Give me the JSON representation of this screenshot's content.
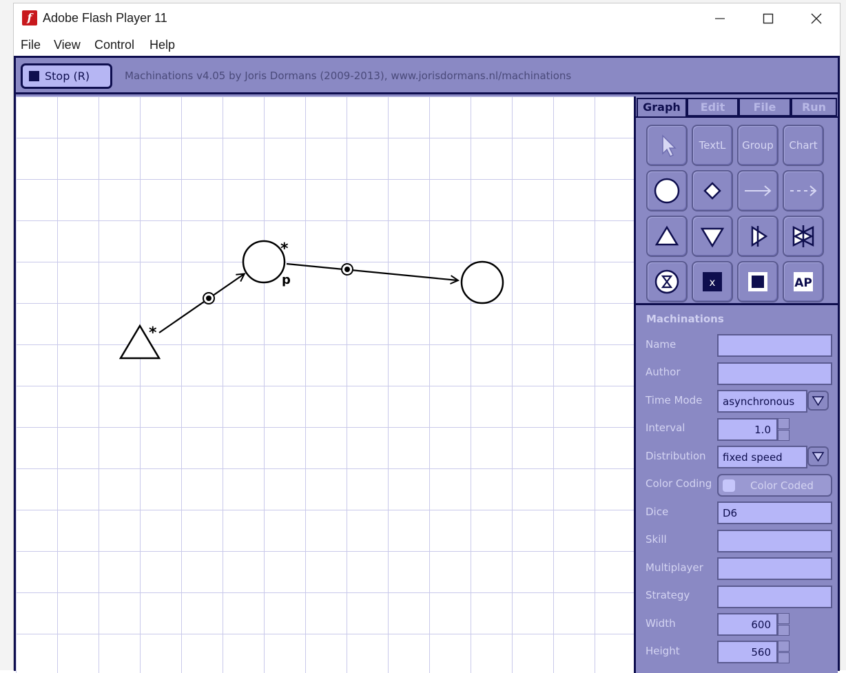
{
  "window": {
    "title": "Adobe Flash Player 11"
  },
  "menu": [
    "File",
    "View",
    "Control",
    "Help"
  ],
  "toolbar": {
    "stop_label": "Stop (R)",
    "credit": "Machinations v4.05 by Joris Dormans (2009-2013), www.jorisdormans.nl/machinations"
  },
  "tabs": [
    "Graph",
    "Edit",
    "File",
    "Run"
  ],
  "active_tab": "Graph",
  "tools": {
    "row1": [
      "select-icon",
      "TextL",
      "Group",
      "Chart"
    ],
    "row2": [
      "pool-icon",
      "gate-icon",
      "state-connection-icon",
      "resource-connection-icon"
    ],
    "row3": [
      "source-icon",
      "drain-icon",
      "converter-icon",
      "trader-icon"
    ],
    "row4": [
      "delay-icon",
      "end-condition-icon",
      "register-icon",
      "artificial-player-icon"
    ],
    "textl": "TextL",
    "group": "Group",
    "chart": "Chart",
    "ap": "AP",
    "end": "x"
  },
  "properties": {
    "title": "Machinations",
    "name_label": "Name",
    "name_value": "",
    "author_label": "Author",
    "author_value": "",
    "time_mode_label": "Time Mode",
    "time_mode_value": "asynchronous",
    "interval_label": "Interval",
    "interval_value": "1.0",
    "distribution_label": "Distribution",
    "distribution_value": "fixed speed",
    "color_coding_label": "Color Coding",
    "color_coding_value": "Color Coded",
    "dice_label": "Dice",
    "dice_value": "D6",
    "skill_label": "Skill",
    "skill_value": "",
    "multiplayer_label": "Multiplayer",
    "multiplayer_value": "",
    "strategy_label": "Strategy",
    "strategy_value": "",
    "width_label": "Width",
    "width_value": "600",
    "height_label": "Height",
    "height_value": "560"
  },
  "diagram": {
    "source_marker": "*",
    "pool_marker": "*",
    "pool_label": "p"
  },
  "colors": {
    "panel": "#8a89c4",
    "dark": "#0e0e4e",
    "field": "#b6b6f8",
    "grid": "#c9c9ea"
  }
}
